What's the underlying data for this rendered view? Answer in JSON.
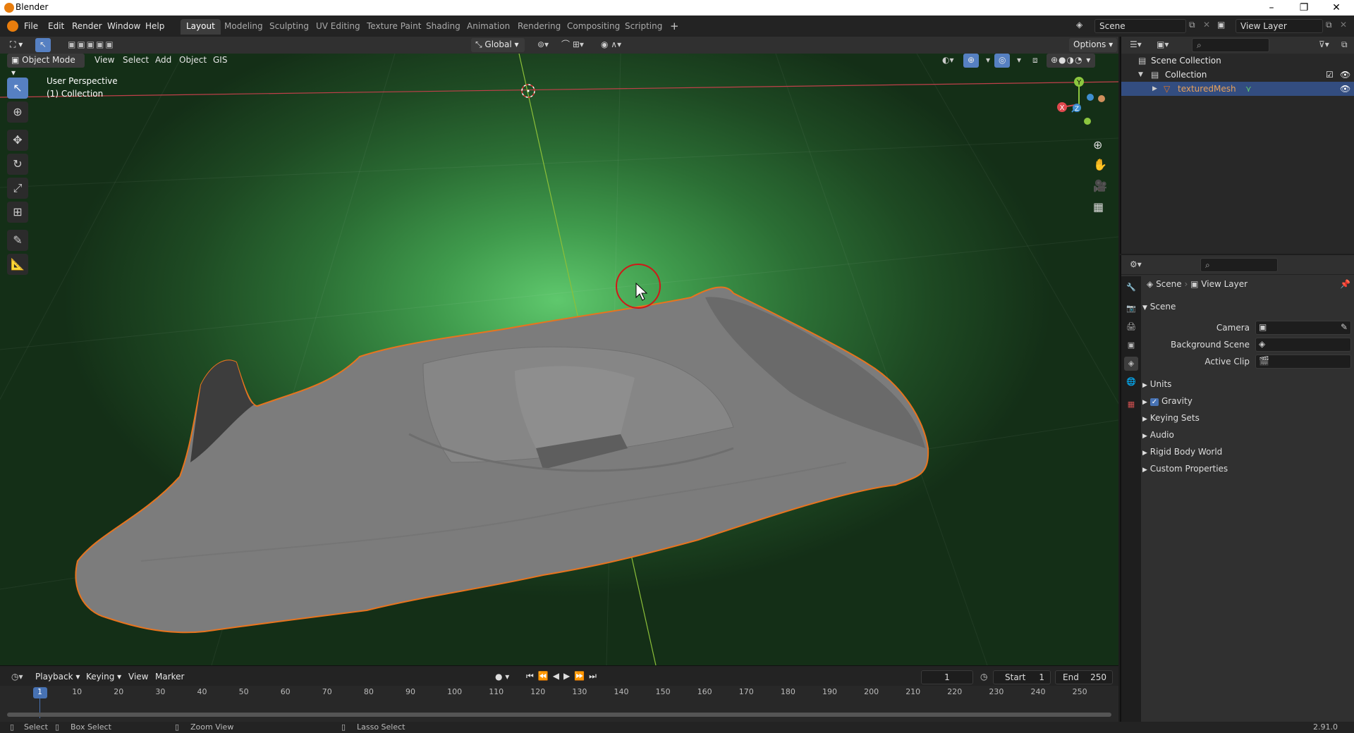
{
  "window": {
    "title": "Blender",
    "controls": [
      "–",
      "❐",
      "✕"
    ]
  },
  "menu": [
    "File",
    "Edit",
    "Render",
    "Window",
    "Help"
  ],
  "workspaces": [
    "Layout",
    "Modeling",
    "Sculpting",
    "UV Editing",
    "Texture Paint",
    "Shading",
    "Animation",
    "Rendering",
    "Compositing",
    "Scripting"
  ],
  "workspace_active": "Layout",
  "scene_field": "Scene",
  "view_layer_field": "View Layer",
  "viewport_header": {
    "mode": "Object Mode",
    "menus": [
      "View",
      "Select",
      "Add",
      "Object",
      "GIS"
    ],
    "orientation": "Global",
    "options": "Options"
  },
  "viewport": {
    "info_line1": "User Perspective",
    "info_line2": "(1) Collection",
    "gizmo": {
      "x": "X",
      "y": "Y",
      "z": "Z"
    }
  },
  "timeline": {
    "menus": [
      "Playback",
      "Keying",
      "View",
      "Marker"
    ],
    "current_frame": "1",
    "start_label": "Start",
    "start_value": "1",
    "end_label": "End",
    "end_value": "250",
    "ticks": [
      "1",
      "10",
      "20",
      "30",
      "40",
      "50",
      "60",
      "70",
      "80",
      "90",
      "100",
      "110",
      "120",
      "130",
      "140",
      "150",
      "160",
      "170",
      "180",
      "190",
      "200",
      "210",
      "220",
      "230",
      "240",
      "250"
    ]
  },
  "statusbar": {
    "select": "Select",
    "box_select": "Box Select",
    "zoom_view": "Zoom View",
    "lasso_select": "Lasso Select",
    "version": "2.91.0"
  },
  "outliner": {
    "scene_collection": "Scene Collection",
    "collection": "Collection",
    "object": "texturedMesh"
  },
  "properties": {
    "breadcrumb_scene": "Scene",
    "breadcrumb_view_layer": "View Layer",
    "panel_scene": "Scene",
    "camera_label": "Camera",
    "background_scene_label": "Background Scene",
    "active_clip_label": "Active Clip",
    "sections": [
      "Units",
      "Gravity",
      "Keying Sets",
      "Audio",
      "Rigid Body World",
      "Custom Properties"
    ]
  },
  "colors": {
    "accent": "#5680c2",
    "selection_outline": "#e8741e",
    "mesh": "#8a8a8a",
    "viewport_glow": "#5fc86d"
  }
}
